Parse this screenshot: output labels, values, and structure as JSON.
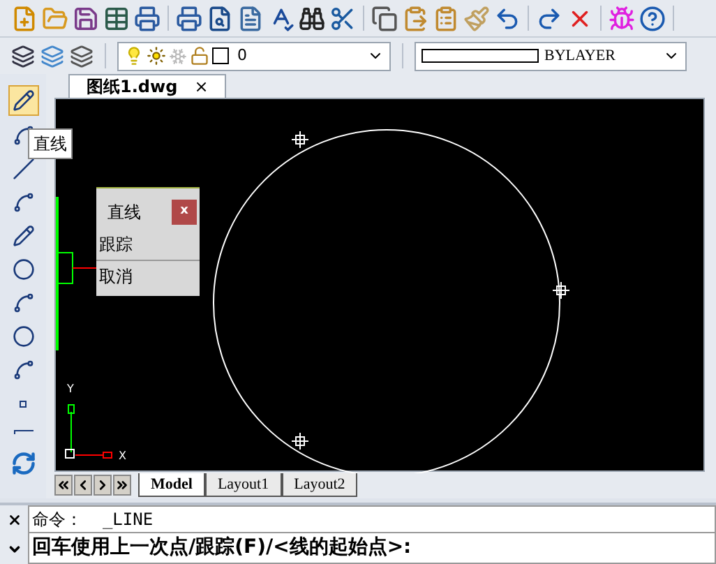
{
  "layer_toolbar": {
    "layer": "0",
    "linetype": "BYLAYER"
  },
  "tooltip": {
    "text": "直线"
  },
  "document_tab": {
    "title": "图纸1.dwg",
    "close": "×"
  },
  "context_menu": {
    "title": "直线",
    "close": "x",
    "items": [
      {
        "label": "跟踪"
      },
      {
        "label": "取消"
      }
    ]
  },
  "axes": {
    "y": "Y",
    "x": "X"
  },
  "layout_tabs": [
    {
      "label": "Model",
      "selected": true
    },
    {
      "label": "Layout1",
      "selected": false
    },
    {
      "label": "Layout2",
      "selected": false
    }
  ],
  "command": {
    "history": "命令：  _LINE",
    "prompt": "回车使用上一次点/跟踪(F)/<线的起始点>:"
  }
}
